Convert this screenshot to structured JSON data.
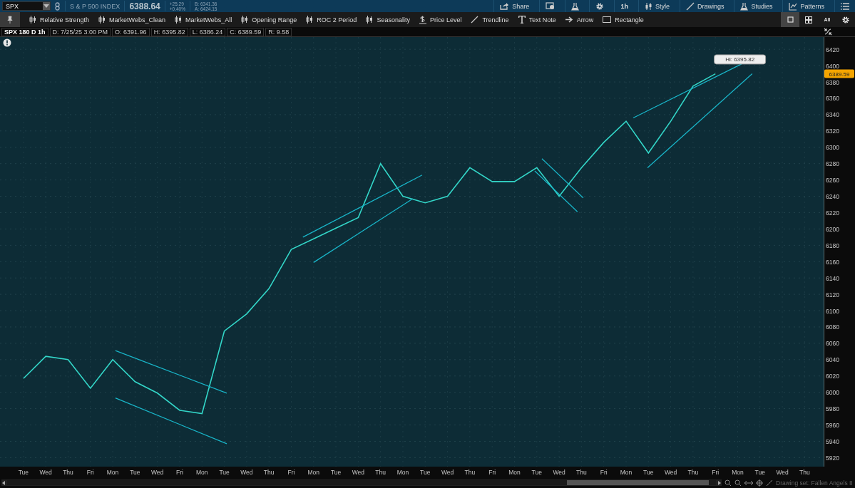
{
  "symbol_bar": {
    "symbol": "SPX",
    "name": "S & P 500 INDEX",
    "last": "6388.64",
    "change": "+25.29",
    "change_pct": "+0.40%",
    "bid": "B: 6341.36",
    "ask": "A: 6424.15"
  },
  "top_actions": [
    {
      "kind": "share",
      "label": "Share"
    },
    {
      "kind": "alert"
    },
    {
      "kind": "flask"
    },
    {
      "kind": "gear"
    },
    {
      "kind": "plain",
      "label": "1h"
    },
    {
      "kind": "style",
      "label": "Style"
    },
    {
      "kind": "drawings",
      "label": "Drawings"
    },
    {
      "kind": "studies",
      "label": "Studies"
    },
    {
      "kind": "patterns",
      "label": "Patterns"
    },
    {
      "kind": "menu"
    }
  ],
  "toolbar": {
    "tools": [
      {
        "kind": "study",
        "label": "Relative Strength"
      },
      {
        "kind": "study",
        "label": "MarketWebs_Clean"
      },
      {
        "kind": "study",
        "label": "MarketWebs_All"
      },
      {
        "kind": "study",
        "label": "Opening Range"
      },
      {
        "kind": "study",
        "label": "ROC 2 Period"
      },
      {
        "kind": "study",
        "label": "Seasonality"
      },
      {
        "kind": "price-level",
        "label": "Price Level"
      },
      {
        "kind": "trendline",
        "label": "Trendline"
      },
      {
        "kind": "text",
        "label": "Text Note"
      },
      {
        "kind": "arrow",
        "label": "Arrow"
      },
      {
        "kind": "rectangle",
        "label": "Rectangle"
      }
    ],
    "layouts": [
      {
        "kind": "single",
        "selected": true
      },
      {
        "kind": "grid",
        "selected": false
      },
      {
        "kind": "all",
        "label": "All",
        "selected": false
      }
    ]
  },
  "info_bar": {
    "title": "SPX 180 D 1h",
    "fields": [
      "D: 7/25/25 3:00 PM",
      "O: 6391.96",
      "H: 6395.82",
      "L: 6386.24",
      "C: 6389.59",
      "R: 9.58"
    ]
  },
  "chart": {
    "price_label": "6389.59",
    "chart_data": {
      "type": "line",
      "categories": [
        "Tue",
        "Wed",
        "Thu",
        "Fri",
        "Mon",
        "Tue",
        "Wed",
        "Fri",
        "Mon",
        "Tue",
        "Wed",
        "Thu",
        "Fri",
        "Mon",
        "Tue",
        "Wed",
        "Thu",
        "Mon",
        "Tue",
        "Wed",
        "Thu",
        "Fri",
        "Mon",
        "Tue",
        "Wed",
        "Thu",
        "Fri",
        "Mon",
        "Tue",
        "Wed",
        "Thu",
        "Fri",
        "Mon",
        "Tue",
        "Wed",
        "Thu"
      ],
      "values": [
        6017,
        6044,
        6040,
        6005,
        6040,
        6013,
        5999,
        5978,
        5974,
        6075,
        6096,
        6127,
        6175,
        6188,
        6201,
        6214,
        6280,
        6240,
        6232,
        6240,
        6275,
        6258,
        6258,
        6275,
        6240,
        6275,
        6306,
        6332,
        6293,
        6332,
        6375,
        6390,
        null,
        null,
        null,
        null
      ],
      "ylim": [
        5909,
        6435
      ],
      "grid": true,
      "yticks": [
        5920,
        5940,
        5960,
        5980,
        6000,
        6020,
        6040,
        6060,
        6080,
        6100,
        6120,
        6140,
        6160,
        6180,
        6200,
        6220,
        6240,
        6260,
        6280,
        6300,
        6320,
        6340,
        6360,
        6380,
        6400,
        6420
      ],
      "annotations": [
        "Hi: 6395.82"
      ]
    }
  },
  "footer": {
    "drawing_set": "Drawing set: Fallen Angels II"
  }
}
